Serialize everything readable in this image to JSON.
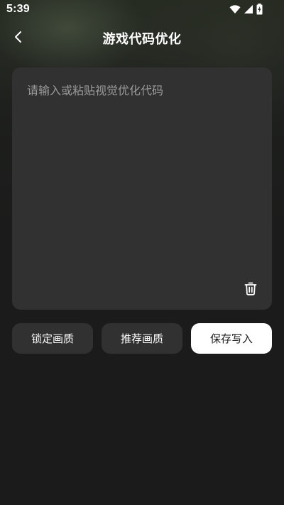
{
  "status_bar": {
    "time": "5:39",
    "icons": [
      "wifi-icon",
      "cellular-signal-icon",
      "battery-charging-icon"
    ]
  },
  "header": {
    "back_icon": "chevron-left-icon",
    "title": "游戏代码优化"
  },
  "editor": {
    "placeholder": "请输入或粘贴视觉优化代码",
    "value": "",
    "clear_icon": "trash-icon"
  },
  "actions": {
    "lock_quality": "锁定画质",
    "recommend_quality": "推荐画质",
    "save_write": "保存写入"
  },
  "colors": {
    "background": "#1b1b1b",
    "card": "#313131",
    "primary_button": "#ffffff",
    "placeholder": "#9a9a9a"
  }
}
